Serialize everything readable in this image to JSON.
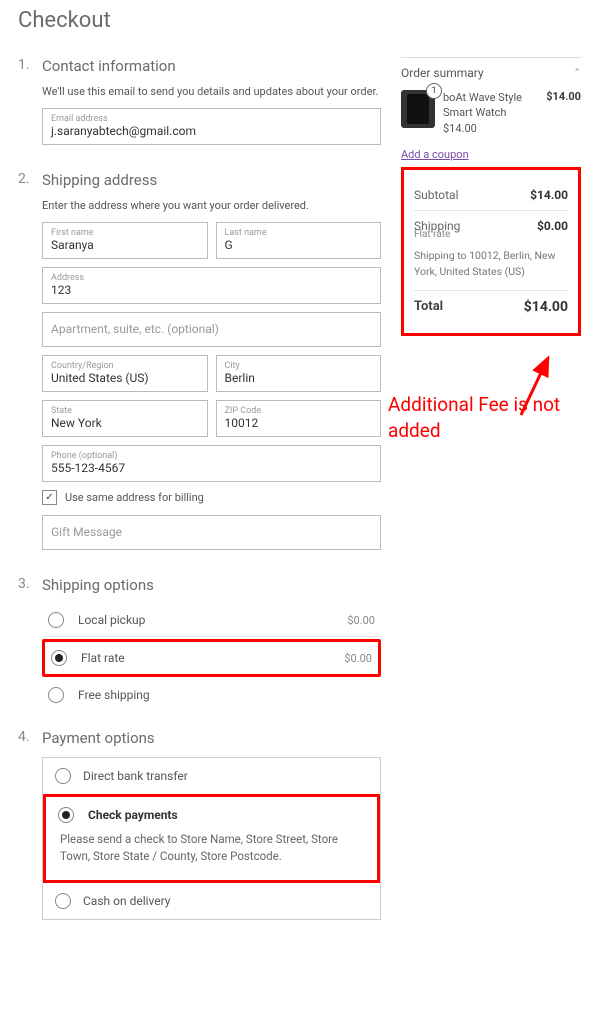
{
  "page_title": "Checkout",
  "sections": {
    "contact": {
      "num": "1.",
      "title": "Contact information",
      "sub": "We'll use this email to send you details and updates about your order.",
      "email_label": "Email address",
      "email_value": "j.saranyabtech@gmail.com"
    },
    "shipping_addr": {
      "num": "2.",
      "title": "Shipping address",
      "sub": "Enter the address where you want your order delivered.",
      "first_name_label": "First name",
      "first_name": "Saranya",
      "last_name_label": "Last name",
      "last_name": "G",
      "address_label": "Address",
      "address": "123",
      "apt_placeholder": "Apartment, suite, etc. (optional)",
      "country_label": "Country/Region",
      "country": "United States (US)",
      "city_label": "City",
      "city": "Berlin",
      "state_label": "State",
      "state": "New York",
      "zip_label": "ZIP Code",
      "zip": "10012",
      "phone_label": "Phone (optional)",
      "phone": "555-123-4567",
      "same_billing": "Use same address for billing",
      "gift_placeholder": "Gift Message"
    },
    "shipping_opts": {
      "num": "3.",
      "title": "Shipping options",
      "options": [
        {
          "label": "Local pickup",
          "price": "$0.00",
          "selected": false
        },
        {
          "label": "Flat rate",
          "price": "$0.00",
          "selected": true
        },
        {
          "label": "Free shipping",
          "price": "",
          "selected": false
        }
      ]
    },
    "payment": {
      "num": "4.",
      "title": "Payment options",
      "options": [
        {
          "label": "Direct bank transfer",
          "selected": false
        },
        {
          "label": "Check payments",
          "selected": true,
          "desc": "Please send a check to Store Name, Store Street, Store Town, Store State / County, Store Postcode."
        },
        {
          "label": "Cash on delivery",
          "selected": false
        }
      ]
    }
  },
  "summary": {
    "title": "Order summary",
    "product": {
      "name": "boAt Wave Style Smart Watch",
      "unit_price": "$14.00",
      "line_price": "$14.00",
      "qty": "1"
    },
    "coupon_link": "Add a coupon",
    "rows": {
      "subtotal_label": "Subtotal",
      "subtotal": "$14.00",
      "shipping_label": "Shipping",
      "shipping": "$0.00",
      "shipping_method": "Flat rate",
      "shipping_to": "Shipping to 10012, Berlin, New York, United States (US)",
      "total_label": "Total",
      "total": "$14.00"
    }
  },
  "annotation": "Additional Fee is not added"
}
